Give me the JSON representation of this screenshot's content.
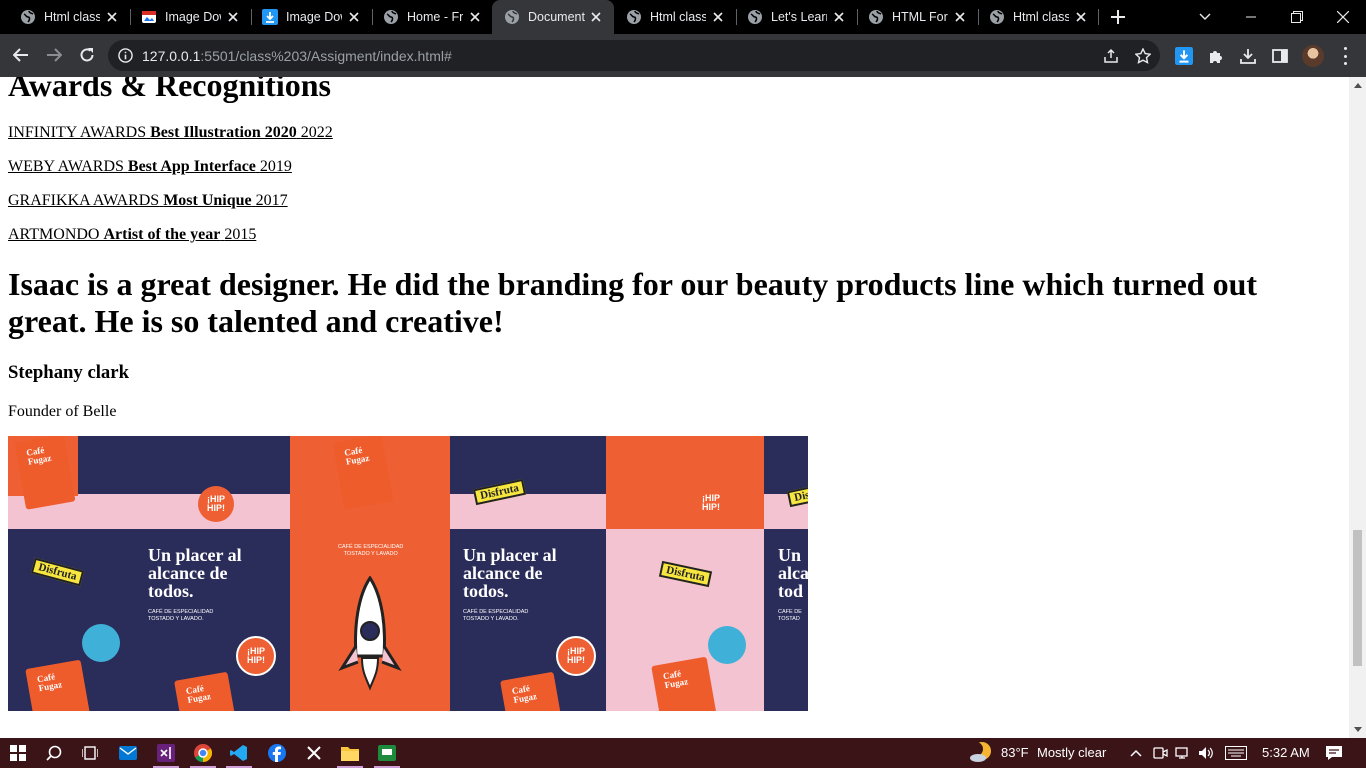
{
  "browser": {
    "tabs": [
      {
        "title": "Html class",
        "icon": "globe-icon",
        "active": false
      },
      {
        "title": "Image Dow",
        "icon": "image-icon",
        "active": false
      },
      {
        "title": "Image Dow",
        "icon": "download-arrow-icon",
        "active": false
      },
      {
        "title": "Home - Fr",
        "icon": "globe-icon",
        "active": false
      },
      {
        "title": "Document",
        "icon": "globe-icon",
        "active": true
      },
      {
        "title": "Html class",
        "icon": "globe-icon",
        "active": false
      },
      {
        "title": "Let's Learn",
        "icon": "globe-icon",
        "active": false
      },
      {
        "title": "HTML Form",
        "icon": "globe-icon",
        "active": false
      },
      {
        "title": "Html class",
        "icon": "globe-icon",
        "active": false
      }
    ],
    "url_host": "127.0.0.1",
    "url_path": ":5501/class%203/Assigment/index.html#"
  },
  "page": {
    "section_title": "Awards & Recognitions",
    "awards": [
      {
        "org": "INFINITY AWARDS",
        "category": "Best Illustration 2020",
        "year": "2022"
      },
      {
        "org": "WEBY AWARDS",
        "category": "Best App Interface",
        "year": "2019"
      },
      {
        "org": "GRAFIKKA AWARDS",
        "category": "Most Unique",
        "year": "2017"
      },
      {
        "org": "ARTMONDO",
        "category": "Artist of the year",
        "year": "2015"
      }
    ],
    "testimonial": "Isaac is a great designer. He did the branding for our beauty products line which turned out great. He is so talented and creative!",
    "author_name": "Stephany clark",
    "author_role": "Founder of Belle",
    "banner": {
      "headline_1": "Un placer al\nalcance de\ntodos.",
      "headline_2": "Un placer al\nalcance de\ntodos.",
      "headline_3": "Un\nalca\ntod",
      "small_1": "CAFÉ DE ESPECIALIDAD\nTOSTADO Y LAVADO.",
      "small_2": "CAFÉ DE ESPECIALIDAD\nTOSTADO Y LAVADO.",
      "small_3": "CAFÉ DE\nTOSTAD",
      "center_tag": "CAFÉ DE ESPECIALIDAD\nTOSTADO Y LAVADO",
      "sticker": "Disfruta",
      "badge": "¡HIP\nHIP!",
      "bag_label": "Café\nFugaz"
    }
  },
  "taskbar": {
    "temperature": "83°F",
    "weather": "Mostly clear",
    "time": "5:32 AM"
  }
}
